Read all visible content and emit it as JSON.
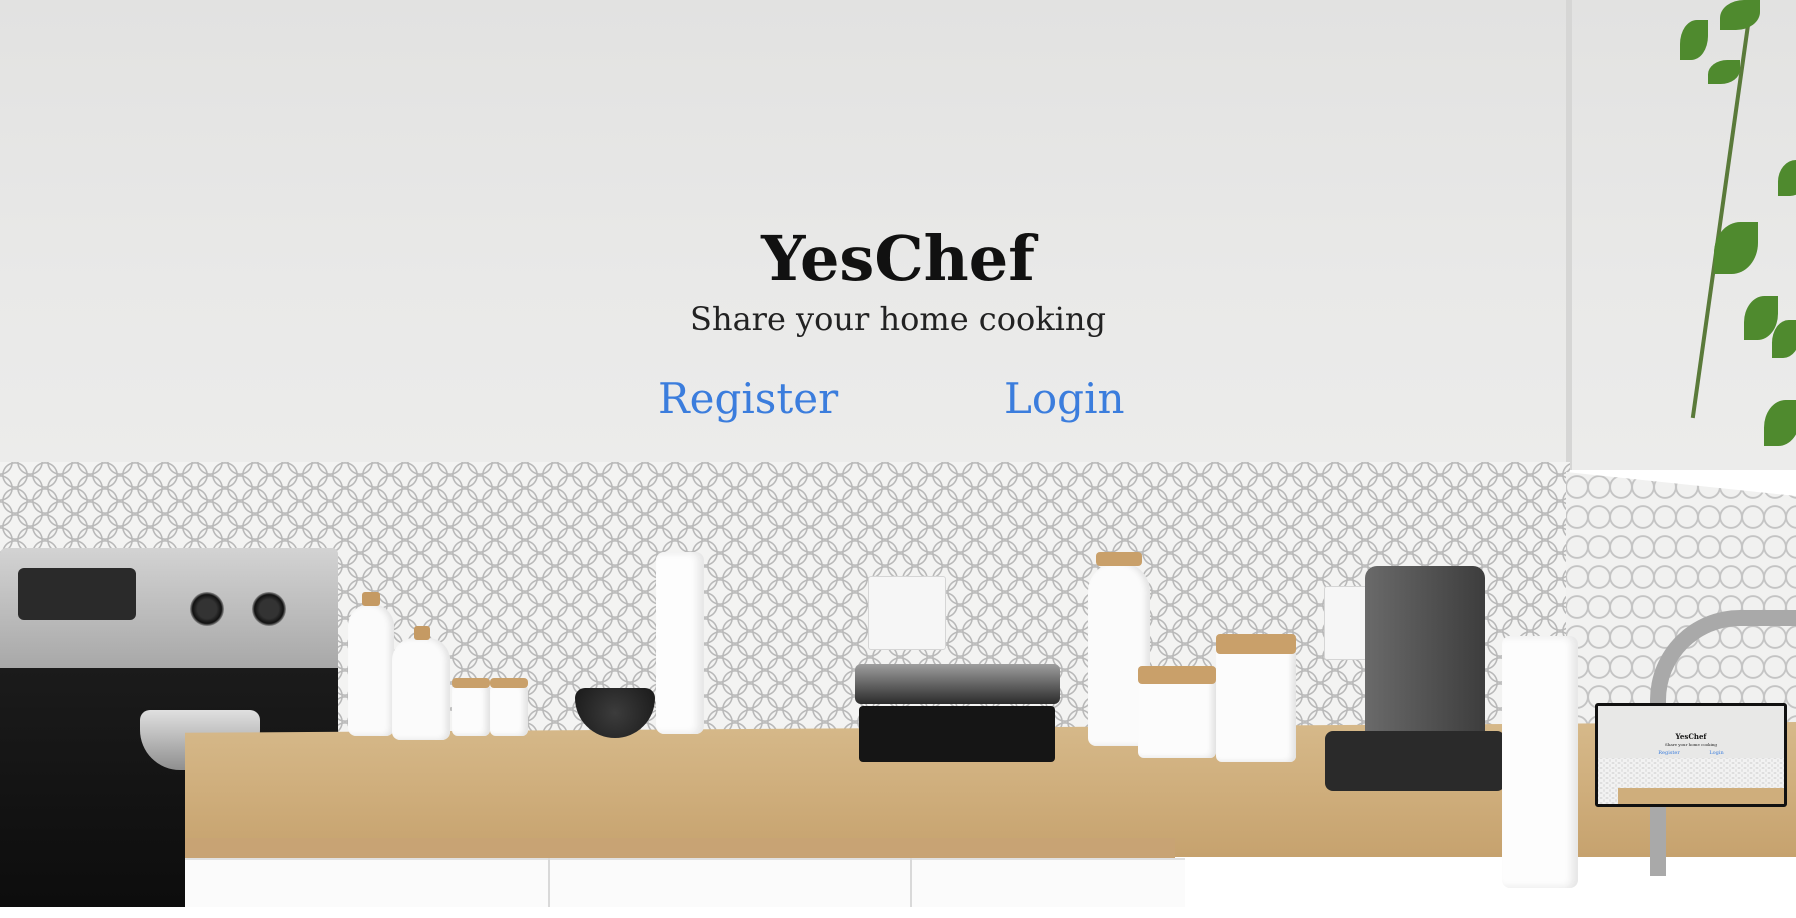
{
  "app": {
    "title": "YesChef",
    "tagline": "Share your home cooking"
  },
  "nav": {
    "register_label": "Register",
    "login_label": "Login"
  },
  "thumbnail": {
    "title": "YesChef",
    "tagline": "Share your home cooking",
    "register_label": "Register",
    "login_label": "Login"
  },
  "colors": {
    "link": "#3b7ddd",
    "title": "#111111",
    "wall": "#e9e9e8",
    "counter": "#cfae7c"
  },
  "background": {
    "description_icon": "kitchen-background-image"
  }
}
